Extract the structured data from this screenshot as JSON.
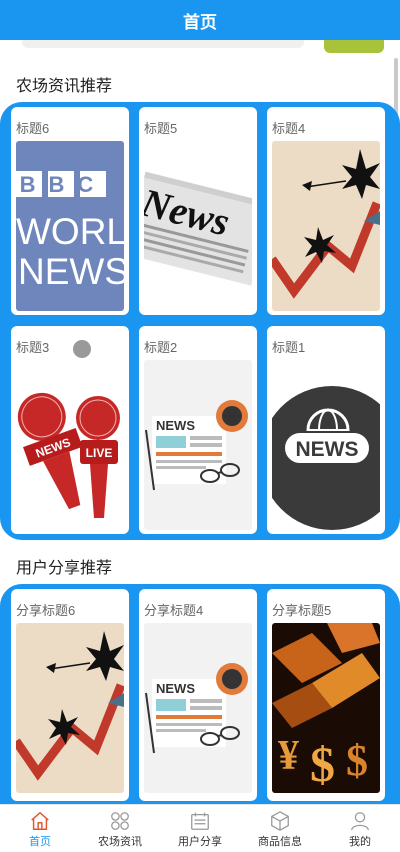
{
  "header": {
    "title": "首页"
  },
  "sections": {
    "farm_news": {
      "title": "农场资讯推荐",
      "cards": [
        {
          "title": "标题6",
          "image": "bbc-world-news"
        },
        {
          "title": "标题5",
          "image": "newspaper-news"
        },
        {
          "title": "标题4",
          "image": "red-graph-burst"
        },
        {
          "title": "标题3",
          "image": "news-microphones"
        },
        {
          "title": "标题2",
          "image": "newspaper-glasses"
        },
        {
          "title": "标题1",
          "image": "news-globe-badge"
        }
      ]
    },
    "user_share": {
      "title": "用户分享推荐",
      "cards": [
        {
          "title": "分享标题6",
          "image": "red-graph-burst"
        },
        {
          "title": "分享标题4",
          "image": "newspaper-glasses"
        },
        {
          "title": "分享标题5",
          "image": "golden-currency"
        }
      ]
    }
  },
  "image_text": {
    "bbc": "BBC",
    "world": "WORLD",
    "news": "NEWS",
    "newspaper": "News",
    "mic_news": "NEWS",
    "live": "LIVE"
  },
  "tabbar": {
    "items": [
      {
        "label": "首页",
        "icon": "home-icon",
        "active": true
      },
      {
        "label": "农场资讯",
        "icon": "grid-circles-icon",
        "active": false
      },
      {
        "label": "用户分享",
        "icon": "share-board-icon",
        "active": false
      },
      {
        "label": "商品信息",
        "icon": "box-icon",
        "active": false
      },
      {
        "label": "我的",
        "icon": "person-icon",
        "active": false
      }
    ]
  },
  "colors": {
    "primary": "#1a96f0",
    "accent_green": "#a8c339"
  }
}
